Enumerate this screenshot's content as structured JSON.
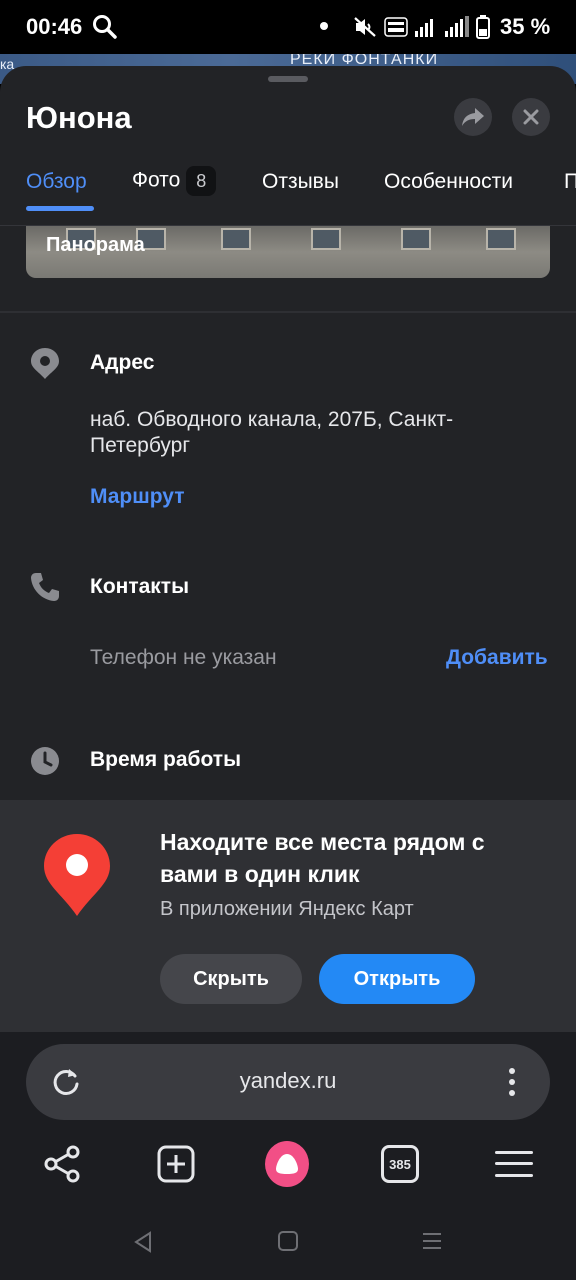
{
  "status": {
    "time": "00:46",
    "battery": "35 %"
  },
  "map": {
    "street_fragment": "РЕКИ ФОНТАНКИ",
    "left_fragment": "ка"
  },
  "sheet": {
    "title": "Юнона",
    "tabs": [
      {
        "label": "Обзор",
        "active": true
      },
      {
        "label": "Фото",
        "badge": "8"
      },
      {
        "label": "Отзывы"
      },
      {
        "label": "Особенности"
      },
      {
        "label": "П"
      }
    ],
    "panorama_label": "Панорама",
    "address": {
      "title": "Адрес",
      "text": "наб. Обводного канала, 207Б, Санкт-Петербург",
      "route_link": "Маршрут"
    },
    "contacts": {
      "title": "Контакты",
      "phone_text": "Телефон не указан",
      "add_link": "Добавить"
    },
    "hours": {
      "title": "Время работы"
    }
  },
  "promo": {
    "title": "Находите все места рядом с вами в один клик",
    "subtitle": "В приложении Яндекс Карт",
    "hide_label": "Скрыть",
    "open_label": "Открыть"
  },
  "browser": {
    "url": "yandex.ru",
    "tabs_count": "385"
  },
  "colors": {
    "accent": "#4f8ef7",
    "sheet_bg": "#222326",
    "promo_bg": "#2f3034",
    "open_button": "#2389f5",
    "alice": "#f24f86",
    "pin": "#f43f36"
  }
}
